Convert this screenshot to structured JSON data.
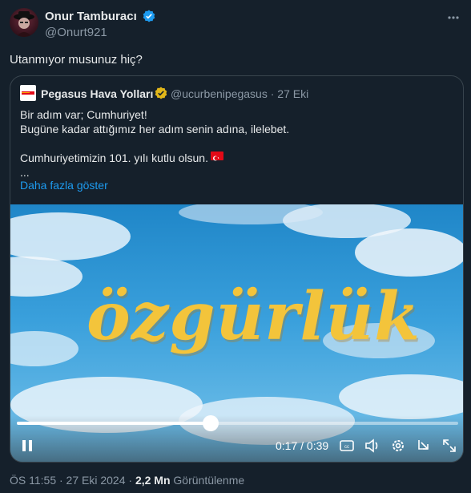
{
  "author": {
    "name": "Onur Tamburacı",
    "handle": "@Onurt921",
    "avatar_icon": "avatar-image",
    "verified_color": "#1d9bf0"
  },
  "tweet": {
    "text": "Utanmıyor musunuz hiç?"
  },
  "quote": {
    "name": "Pegasus Hava Yolları",
    "handle": "@ucurbenipegasus · 27 Eki",
    "badge_color": "#e2b719",
    "lines": [
      "Bir adım var; Cumhuriyet!",
      "Bugüne kadar attığımız her adım senin adına, ilelebet.",
      "",
      "Cumhuriyetimizin 101. yılı kutlu olsun.",
      "..."
    ],
    "show_more": "Daha fazla göster"
  },
  "video": {
    "overlay_word": "özgürlük",
    "current_time": "0:17",
    "duration": "0:39",
    "timecode": "0:17 / 0:39",
    "progress": 0.44
  },
  "meta": {
    "time_date": "ÖS 11:55 · 27 Eki 2024 · ",
    "views_count": "2,2 Mn",
    "views_label": "Görüntülenme"
  }
}
